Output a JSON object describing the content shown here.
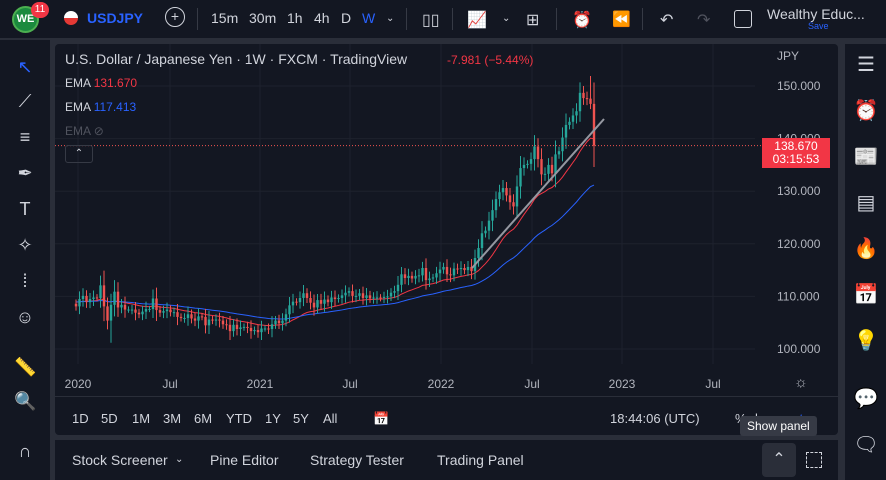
{
  "topbar": {
    "logo": "WE",
    "notifications": "11",
    "symbol": "USDJPY",
    "intervals": [
      "15m",
      "30m",
      "1h",
      "4h",
      "D",
      "W"
    ],
    "active_interval": "W",
    "account": "Wealthy Educ...",
    "save": "Save"
  },
  "legend": {
    "title": "U.S. Dollar / Japanese Yen · 1W · FXCM · TradingView",
    "change": "-7.981 (−5.44%)",
    "ema1_label": "EMA",
    "ema1_value": "131.670",
    "ema2_label": "EMA",
    "ema2_value": "117.413",
    "ema3_label": "EMA"
  },
  "price_axis": {
    "currency": "JPY",
    "current_price": "138.670",
    "countdown": "03:15:53"
  },
  "time_footer": {
    "ranges": [
      "1D",
      "5D",
      "1M",
      "3M",
      "6M",
      "YTD",
      "1Y",
      "5Y",
      "All"
    ],
    "clock": "18:44:06 (UTC)",
    "pct": "%",
    "log": "log",
    "auto": "auto"
  },
  "bottom": {
    "tabs": [
      "Stock Screener",
      "Pine Editor",
      "Strategy Tester",
      "Trading Panel"
    ],
    "tooltip": "Show panel"
  },
  "colors": {
    "up": "#26a69a",
    "down": "#ef5350",
    "ema_red": "#f23645",
    "ema_blue": "#2962ff",
    "accent": "#2962ff"
  },
  "chart_data": {
    "type": "candlestick",
    "x_ticks": [
      "2020",
      "Jul",
      "2021",
      "Jul",
      "2022",
      "Jul",
      "2023",
      "Jul"
    ],
    "y_ticks": [
      100,
      110,
      120,
      130,
      140,
      150
    ],
    "ylim": [
      96,
      153
    ],
    "weekly_closes": [
      108.1,
      109.5,
      110.1,
      108.9,
      109.5,
      109.8,
      109.7,
      112.1,
      108.1,
      105.4,
      108.4,
      110.9,
      107.9,
      108.4,
      107.5,
      107.5,
      107.5,
      106.9,
      106.6,
      107.1,
      107.6,
      107.6,
      109.6,
      107.4,
      106.9,
      107.2,
      107.5,
      107.0,
      107.0,
      106.1,
      105.9,
      105.9,
      106.6,
      105.8,
      105.4,
      106.2,
      106.1,
      104.5,
      105.6,
      105.4,
      105.6,
      105.4,
      104.7,
      104.6,
      103.4,
      104.6,
      103.8,
      104.1,
      104.2,
      104.0,
      103.4,
      103.6,
      103.2,
      103.9,
      103.9,
      103.8,
      104.7,
      105.4,
      104.9,
      105.4,
      106.6,
      108.3,
      109.0,
      108.9,
      109.7,
      110.6,
      109.7,
      108.8,
      107.9,
      109.3,
      108.6,
      109.4,
      108.9,
      109.8,
      109.5,
      109.7,
      110.2,
      110.7,
      111.0,
      110.1,
      110.1,
      110.6,
      109.7,
      110.2,
      109.6,
      109.8,
      109.8,
      109.7,
      109.9,
      110.0,
      110.7,
      111.0,
      112.2,
      114.2,
      113.5,
      113.9,
      113.4,
      113.9,
      114.0,
      115.4,
      113.1,
      113.4,
      113.6,
      114.4,
      115.1,
      115.6,
      114.2,
      114.0,
      115.3,
      115.2,
      115.4,
      115.0,
      115.6,
      114.8,
      117.3,
      119.2,
      122.0,
      122.5,
      124.4,
      126.4,
      128.5,
      129.8,
      130.6,
      129.2,
      127.9,
      127.1,
      130.9,
      134.4,
      135.0,
      135.2,
      136.1,
      138.5,
      136.1,
      133.2,
      133.3,
      135.0,
      133.4,
      137.0,
      137.6,
      140.2,
      142.6,
      143.2,
      144.4,
      145.2,
      148.7,
      147.7,
      147.6,
      146.6,
      138.67
    ],
    "series": [
      {
        "name": "EMA",
        "value": 131.67
      },
      {
        "name": "EMA",
        "value": 117.413
      }
    ]
  }
}
